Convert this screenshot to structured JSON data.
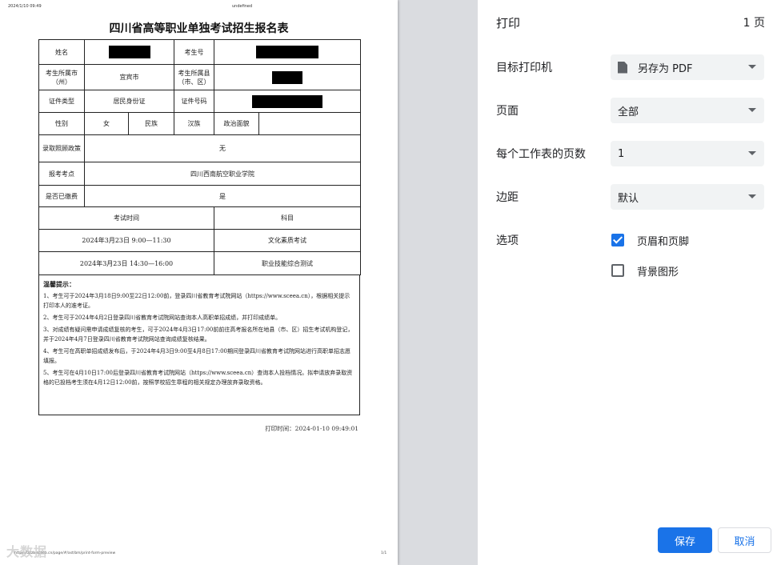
{
  "preview": {
    "header_date": "2024/1/10 09:49",
    "header_title": "undefined",
    "doc_title": "四川省高等职业单独考试招生报名表",
    "form": {
      "name_label": "姓名",
      "exam_no_label": "考生号",
      "city_label": "考生所属市（州）",
      "city_value": "宜宾市",
      "county_label": "考生所属县（市、区）",
      "id_type_label": "证件类型",
      "id_type_value": "居民身份证",
      "id_no_label": "证件号码",
      "gender_label": "性别",
      "gender_value": "女",
      "ethnicity_label": "民族",
      "ethnicity_value": "汉族",
      "political_label": "政治面貌",
      "political_value": "",
      "policy_label": "录取照顾政策",
      "policy_value": "无",
      "site_label": "报考考点",
      "site_value": "四川西南航空职业学院",
      "paid_label": "是否已缴费",
      "paid_value": "是",
      "schedule_header_time": "考试时间",
      "schedule_header_subject": "科目",
      "schedule": [
        {
          "time": "2024年3月23日 9:00—11:30",
          "subject": "文化素质考试"
        },
        {
          "time": "2024年3月23日 14:30—16:00",
          "subject": "职业技能综合测试"
        }
      ]
    },
    "notice": {
      "title": "温馨提示：",
      "items": [
        "1、考生可于2024年3月18日9:00至22日12:00前，登录四川省教育考试院网站（https://www.sceea.cn），根据相关提示打印本人的准考证。",
        "2、考生可于2024年4月2日登录四川省教育考试院网站查询本人高职单招成绩，并打印成绩单。",
        "3、对成绩有疑问需申请成绩复核的考生，可于2024年4月3日17:00前前往高考报名所在地县（市、区）招生考试机构登记，并于2024年4月7日登录四川省教育考试院网站查询成绩复核结果。",
        "4、考生可在高职单招成绩发布后，于2024年4月3日9:00至4月8日17:00期间登录四川省教育考试院网站进行高职单招志愿填报。",
        "5、考生可在4月10日17:00后登录四川省教育考试院网站（https://www.sceea.cn）查询本人投档情况。拟申请放弃录取资格的已投档考生须在4月12日12:00前，按照学校招生章程的相关规定办理放弃录取资格。"
      ]
    },
    "print_time": "打印时间：2024-01-10 09:49:01",
    "footer_url": "https://zzzb.sceea.cn/page/#/ast/bm/print-form-preview",
    "footer_page": "1/1",
    "watermark": "大数据"
  },
  "panel": {
    "title": "打印",
    "page_count": "1 页",
    "printer_label": "目标打印机",
    "printer_value": "另存为 PDF",
    "pages_label": "页面",
    "pages_value": "全部",
    "per_sheet_label": "每个工作表的页数",
    "per_sheet_value": "1",
    "margins_label": "边距",
    "margins_value": "默认",
    "options_label": "选项",
    "opt_headers_label": "页眉和页脚",
    "opt_headers_checked": true,
    "opt_bg_label": "背景图形",
    "opt_bg_checked": false,
    "save_label": "保存",
    "cancel_label": "取消"
  },
  "colors": {
    "accent": "#1a73e8",
    "select_bg": "#f1f3f4",
    "preview_bg": "#dadce0"
  }
}
